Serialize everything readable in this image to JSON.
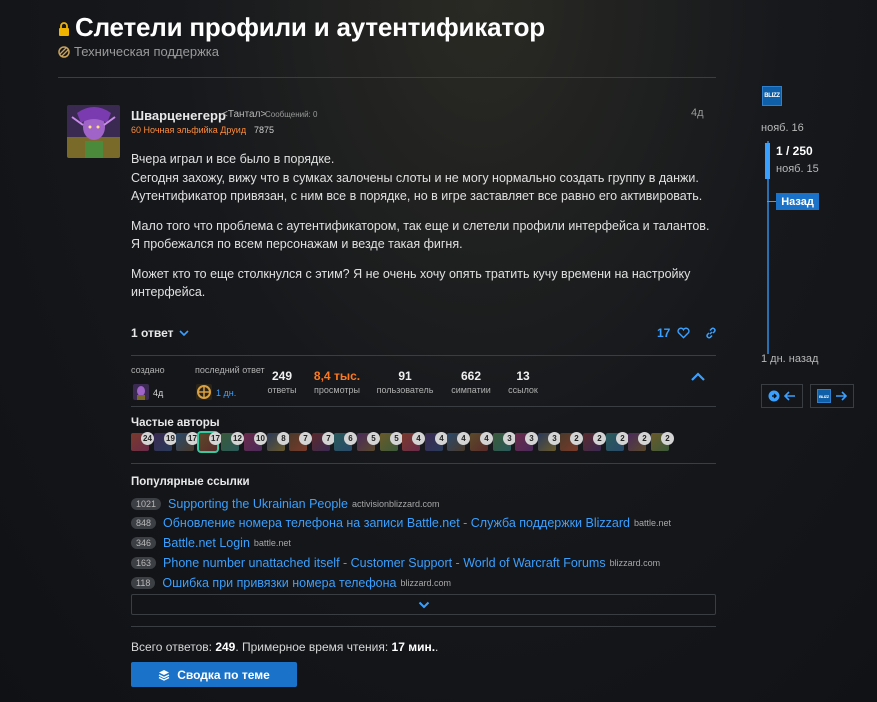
{
  "topic": {
    "title": "Слетели профили и аутентификатор",
    "category": "Техническая поддержка"
  },
  "post": {
    "username": "Шварценегерр",
    "realm": "<Тантал>",
    "posts_count": "Сообщений: 0",
    "character": "60 Ночная эльфийка Друид",
    "achievements": "7875",
    "age": "4д",
    "paragraphs": [
      [
        "Вчера играл и все было в порядке.",
        "Сегодня захожу, вижу что в сумках залочены слоты и не могу нормально создать группу в данжи.",
        "Аутентификатор привязан, с ним все в порядке, но в игре заставляет все равно его активировать."
      ],
      [
        "Мало того что проблема с аутентификатором, так еще и слетели профили интерфейса и талантов. Я пробежался по всем персонажам и везде такая фигня."
      ],
      [
        "Может кто то еще столкнулся с этим? Я не очень хочу опять тратить кучу времени на настройку интерфейса."
      ]
    ],
    "replies_label": "1 ответ",
    "likes": "17"
  },
  "stats": {
    "created_label": "создано",
    "created_age": "4д",
    "last_reply_label": "последний ответ",
    "last_reply_age": "1 дн.",
    "items": [
      {
        "num": "249",
        "label": "ответы"
      },
      {
        "num": "8,4 тыс.",
        "label": "просмотры"
      },
      {
        "num": "91",
        "label": "пользователь"
      },
      {
        "num": "662",
        "label": "симпатии"
      },
      {
        "num": "13",
        "label": "ссылок"
      }
    ]
  },
  "frequent_authors": {
    "title": "Частые авторы",
    "counts": [
      "24",
      "19",
      "17",
      "17",
      "12",
      "10",
      "8",
      "7",
      "7",
      "6",
      "5",
      "5",
      "4",
      "4",
      "4",
      "4",
      "3",
      "3",
      "3",
      "2",
      "2",
      "2",
      "2",
      "2"
    ]
  },
  "popular_links": {
    "title": "Популярные ссылки",
    "items": [
      {
        "count": "1021",
        "title": "Supporting the Ukrainian People",
        "domain": "activisionblizzard.com"
      },
      {
        "count": "848",
        "title": "Обновление номера телефона на записи Battle.net - Служба поддержки Blizzard",
        "domain": "battle.net"
      },
      {
        "count": "346",
        "title": "Battle.net Login",
        "domain": "battle.net"
      },
      {
        "count": "163",
        "title": "Phone number unattached itself - Customer Support - World of Warcraft Forums",
        "domain": "blizzard.com"
      },
      {
        "count": "118",
        "title": "Ошибка при привязки номера телефона",
        "domain": "blizzard.com"
      }
    ]
  },
  "summary": {
    "prefix": "Всего ответов: ",
    "replies": "249",
    "mid": ". Примерное время чтения: ",
    "time": "17 мин.",
    "suffix": ".",
    "button_label": "Сводка по теме"
  },
  "timeline": {
    "logo_text": "BLIZZ",
    "start_date": "нояб. 16",
    "position": "1 / 250",
    "position_date": "нояб. 15",
    "back_label": "Назад",
    "end_date": "1 дн. назад"
  },
  "colors": {
    "accent": "#3aa0ff",
    "button": "#1a73c9",
    "hot": "#ff7a1f",
    "class_color": "#ff8c3a"
  }
}
